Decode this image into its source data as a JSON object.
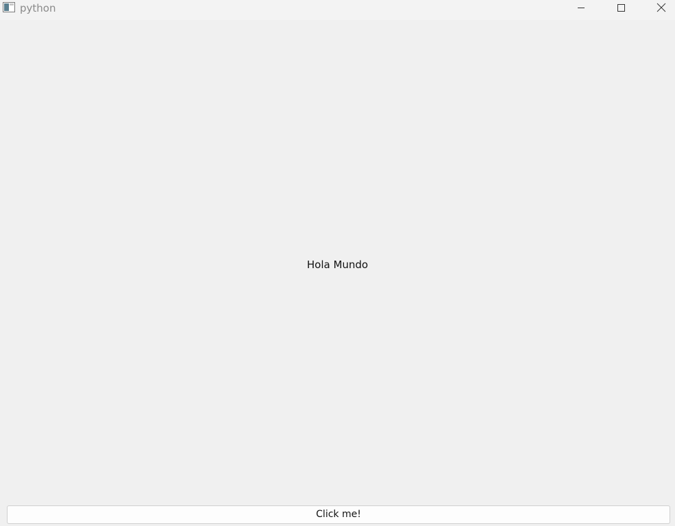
{
  "window": {
    "title": "python",
    "controls": {
      "minimize_icon": "minimize-icon",
      "maximize_icon": "maximize-icon",
      "close_icon": "close-icon"
    }
  },
  "main": {
    "label_text": "Hola Mundo",
    "button_label": "Click me!"
  },
  "colors": {
    "background": "#f0f0f0",
    "titlebar": "#f3f3f3",
    "title_text": "#8a8a8a",
    "text": "#111111",
    "button_bg": "#fdfdfd",
    "button_border": "#d0d0d0"
  }
}
